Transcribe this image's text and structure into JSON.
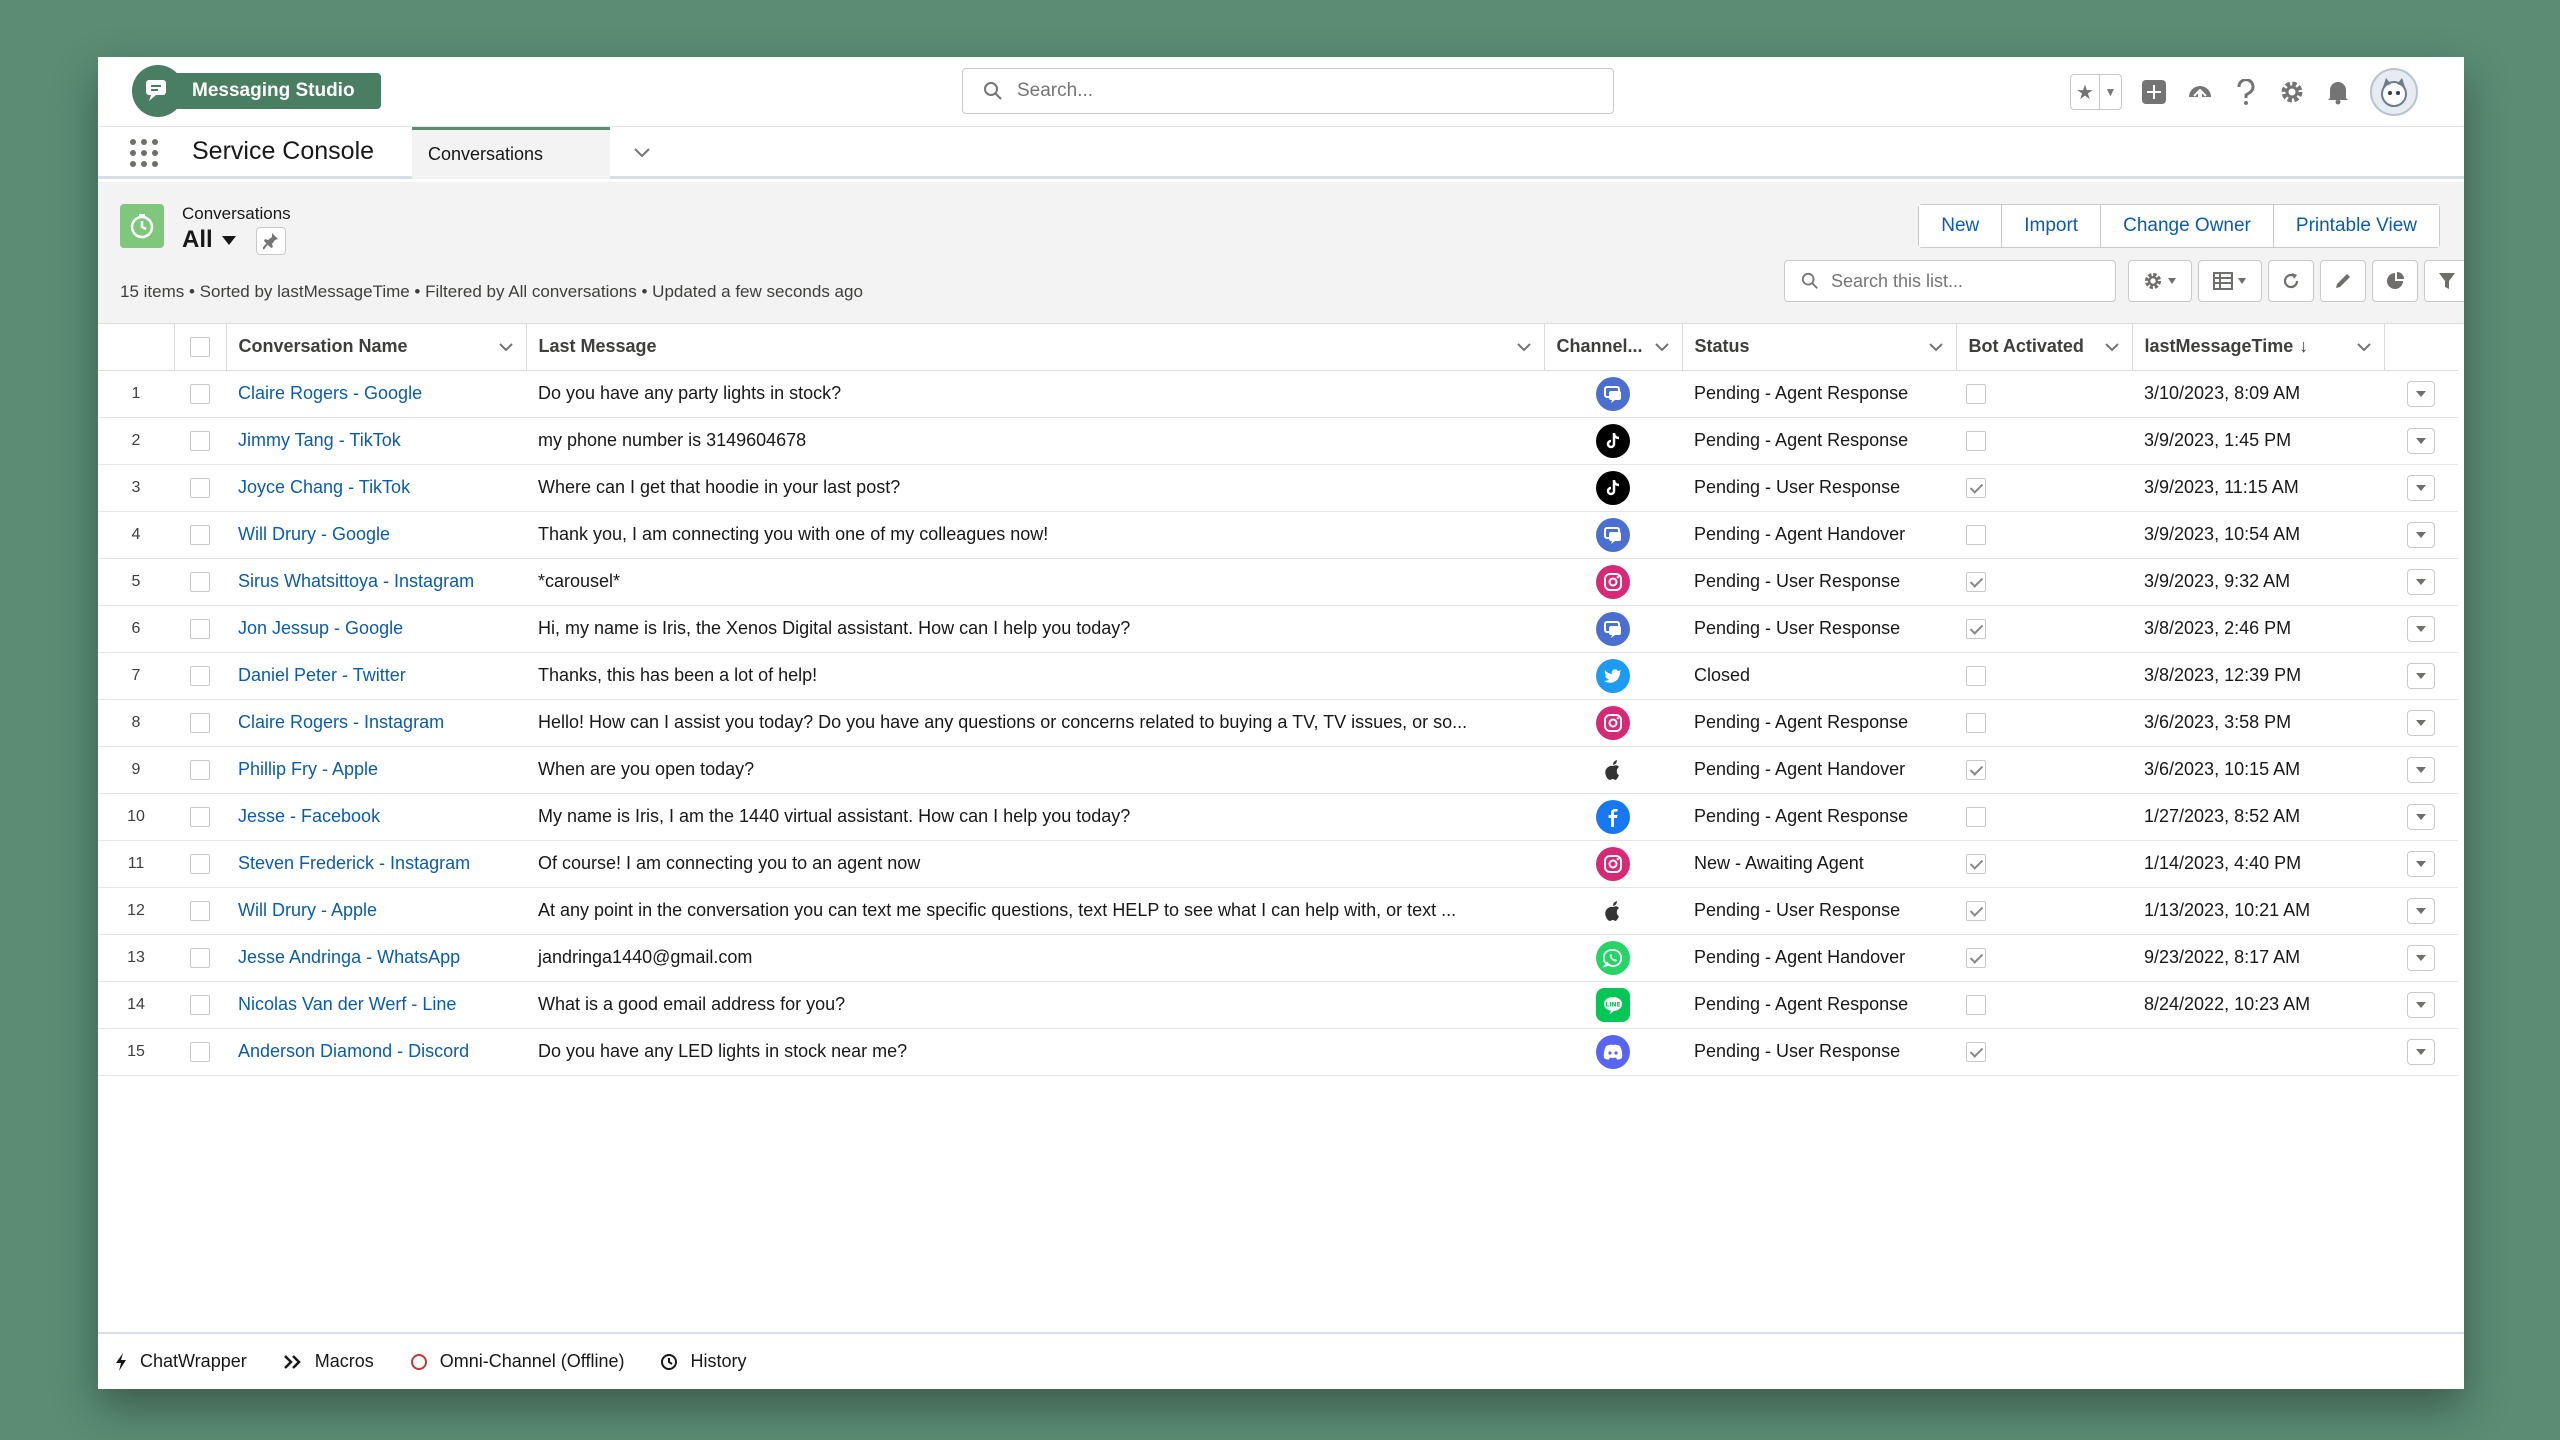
{
  "header": {
    "brand": "Messaging Studio",
    "search_placeholder": "Search..."
  },
  "app_bar": {
    "app_name": "Service Console",
    "tab_label": "Conversations"
  },
  "list": {
    "object_label": "Conversations",
    "view_name": "All",
    "actions": [
      "New",
      "Import",
      "Change Owner",
      "Printable View"
    ],
    "info": "15 items • Sorted by lastMessageTime • Filtered by All conversations • Updated a few seconds ago",
    "search_placeholder": "Search this list..."
  },
  "columns": {
    "name": "Conversation Name",
    "last_message": "Last Message",
    "channel": "Channel...",
    "status": "Status",
    "bot": "Bot Activated",
    "time": "lastMessageTime"
  },
  "rows": [
    {
      "num": "1",
      "name": "Claire Rogers - Google",
      "message": "Do you have any party lights in stock?",
      "channel": "google",
      "status": "Pending - Agent Response",
      "bot": false,
      "time": "3/10/2023, 8:09 AM"
    },
    {
      "num": "2",
      "name": "Jimmy Tang - TikTok",
      "message": "my phone number is 3149604678",
      "channel": "tiktok",
      "status": "Pending - Agent Response",
      "bot": false,
      "time": "3/9/2023, 1:45 PM"
    },
    {
      "num": "3",
      "name": "Joyce Chang - TikTok",
      "message": "Where can I get that hoodie in your last post?",
      "channel": "tiktok",
      "status": "Pending - User Response",
      "bot": true,
      "time": "3/9/2023, 11:15 AM"
    },
    {
      "num": "4",
      "name": "Will Drury - Google",
      "message": "Thank you, I am connecting you with one of my colleagues now!",
      "channel": "google",
      "status": "Pending - Agent Handover",
      "bot": false,
      "time": "3/9/2023, 10:54 AM"
    },
    {
      "num": "5",
      "name": "Sirus Whatsittoya - Instagram",
      "message": "*carousel*",
      "channel": "instagram",
      "status": "Pending - User Response",
      "bot": true,
      "time": "3/9/2023, 9:32 AM"
    },
    {
      "num": "6",
      "name": "Jon Jessup - Google",
      "message": "Hi, my name is Iris, the Xenos Digital assistant. How can I help you today?",
      "channel": "google",
      "status": "Pending - User Response",
      "bot": true,
      "time": "3/8/2023, 2:46 PM"
    },
    {
      "num": "7",
      "name": "Daniel Peter - Twitter",
      "message": "Thanks, this has been a lot of help!",
      "channel": "twitter",
      "status": "Closed",
      "bot": false,
      "time": "3/8/2023, 12:39 PM"
    },
    {
      "num": "8",
      "name": "Claire Rogers - Instagram",
      "message": "Hello! How can I assist you today? Do you have any questions or concerns related to buying a TV, TV issues, or so...",
      "channel": "instagram",
      "status": "Pending - Agent Response",
      "bot": false,
      "time": "3/6/2023, 3:58 PM"
    },
    {
      "num": "9",
      "name": "Phillip Fry - Apple",
      "message": "When are you open today?",
      "channel": "apple",
      "status": "Pending - Agent Handover",
      "bot": true,
      "time": "3/6/2023, 10:15 AM"
    },
    {
      "num": "10",
      "name": "Jesse - Facebook",
      "message": "My name is Iris, I am the 1440 virtual assistant. How can I help you today?",
      "channel": "facebook",
      "status": "Pending - Agent Response",
      "bot": false,
      "time": "1/27/2023, 8:52 AM"
    },
    {
      "num": "11",
      "name": "Steven Frederick - Instagram",
      "message": "Of course! I am connecting you to an agent now",
      "channel": "instagram",
      "status": "New - Awaiting Agent",
      "bot": true,
      "time": "1/14/2023, 4:40 PM"
    },
    {
      "num": "12",
      "name": "Will Drury - Apple",
      "message": "At any point in the conversation you can text me specific questions, text HELP to see what I can help with, or text ...",
      "channel": "apple",
      "status": "Pending - User Response",
      "bot": true,
      "time": "1/13/2023, 10:21 AM"
    },
    {
      "num": "13",
      "name": "Jesse Andringa - WhatsApp",
      "message": "jandringa1440@gmail.com",
      "channel": "whatsapp",
      "status": "Pending - Agent Handover",
      "bot": true,
      "time": "9/23/2022, 8:17 AM"
    },
    {
      "num": "14",
      "name": "Nicolas Van der Werf - Line",
      "message": "What is a good email address for you?",
      "channel": "line",
      "status": "Pending - Agent Response",
      "bot": false,
      "time": "8/24/2022, 10:23 AM"
    },
    {
      "num": "15",
      "name": "Anderson Diamond - Discord",
      "message": "Do you have any LED lights in stock near me?",
      "channel": "discord",
      "status": "Pending - User Response",
      "bot": true,
      "time": ""
    }
  ],
  "channel_colors": {
    "google": "#4a6fcf",
    "tiktok": "#000000",
    "instagram": "#d62976",
    "twitter": "#1d9bf0",
    "apple": "#333333",
    "facebook": "#1877f2",
    "whatsapp": "#25d366",
    "line": "#06c755",
    "discord": "#5865f2"
  },
  "utility": {
    "items": [
      "ChatWrapper",
      "Macros",
      "Omni-Channel (Offline)",
      "History"
    ]
  },
  "accent_color": "#4a7e62"
}
